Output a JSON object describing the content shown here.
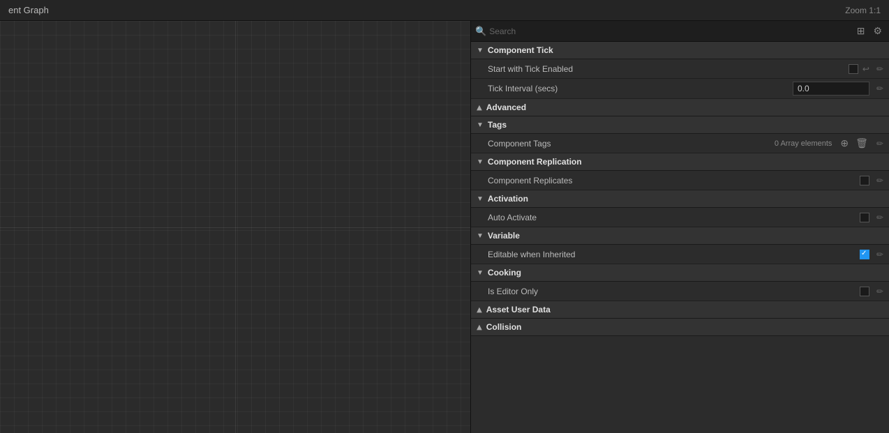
{
  "topBar": {
    "title": "ent Graph",
    "zoom": "Zoom 1:1"
  },
  "searchBar": {
    "placeholder": "Search",
    "gridIcon": "⊞",
    "settingsIcon": "⚙"
  },
  "sections": [
    {
      "id": "component-tick",
      "label": "Component Tick",
      "expanded": true,
      "properties": [
        {
          "id": "start-tick-enabled",
          "label": "Start with Tick Enabled",
          "type": "checkbox",
          "checked": false,
          "hasReset": true,
          "hasEdit": true
        },
        {
          "id": "tick-interval",
          "label": "Tick Interval (secs)",
          "type": "input",
          "value": "0.0",
          "hasEdit": true
        }
      ]
    },
    {
      "id": "advanced",
      "label": "Advanced",
      "expanded": false,
      "properties": []
    },
    {
      "id": "tags",
      "label": "Tags",
      "expanded": true,
      "properties": [
        {
          "id": "component-tags",
          "label": "Component Tags",
          "type": "array",
          "arrayCount": "0 Array elements",
          "hasAdd": true,
          "hasDelete": true,
          "hasEdit": true
        }
      ]
    },
    {
      "id": "component-replication",
      "label": "Component Replication",
      "expanded": true,
      "properties": [
        {
          "id": "component-replicates",
          "label": "Component Replicates",
          "type": "checkbox",
          "checked": false,
          "hasEdit": true
        }
      ]
    },
    {
      "id": "activation",
      "label": "Activation",
      "expanded": true,
      "properties": [
        {
          "id": "auto-activate",
          "label": "Auto Activate",
          "type": "checkbox",
          "checked": false,
          "hasEdit": true
        }
      ]
    },
    {
      "id": "variable",
      "label": "Variable",
      "expanded": true,
      "properties": [
        {
          "id": "editable-when-inherited",
          "label": "Editable when Inherited",
          "type": "checkbox",
          "checked": true,
          "hasEdit": true
        }
      ]
    },
    {
      "id": "cooking",
      "label": "Cooking",
      "expanded": true,
      "properties": [
        {
          "id": "is-editor-only",
          "label": "Is Editor Only",
          "type": "checkbox",
          "checked": false,
          "hasEdit": true
        }
      ]
    },
    {
      "id": "asset-user-data",
      "label": "Asset User Data",
      "expanded": false,
      "properties": []
    },
    {
      "id": "collision",
      "label": "Collision",
      "expanded": false,
      "properties": []
    }
  ]
}
